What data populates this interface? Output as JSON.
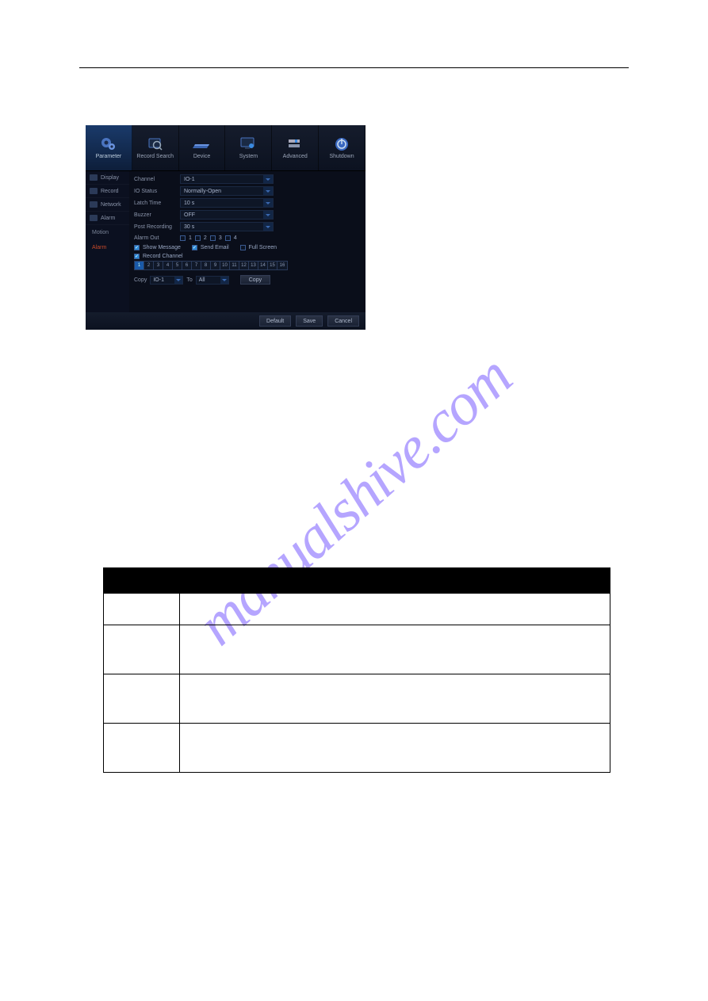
{
  "watermark": "manualshive.com",
  "toolbar": {
    "items": [
      {
        "label": "Parameter",
        "icon": "gears-icon",
        "active": true
      },
      {
        "label": "Record Search",
        "icon": "magnifier-icon"
      },
      {
        "label": "Device",
        "icon": "device-icon"
      },
      {
        "label": "System",
        "icon": "monitor-icon"
      },
      {
        "label": "Advanced",
        "icon": "advanced-icon"
      },
      {
        "label": "Shutdown",
        "icon": "power-icon"
      }
    ]
  },
  "sidebar": {
    "items": [
      {
        "label": "Display",
        "icon": "display-icon"
      },
      {
        "label": "Record",
        "icon": "record-icon"
      },
      {
        "label": "Network",
        "icon": "network-icon"
      },
      {
        "label": "Alarm",
        "icon": "alarm-icon"
      }
    ],
    "sub": [
      {
        "label": "Motion"
      },
      {
        "label": "Alarm",
        "active": true
      }
    ]
  },
  "form": {
    "channel": {
      "label": "Channel",
      "value": "IO-1"
    },
    "io_status": {
      "label": "IO Status",
      "value": "Normally-Open"
    },
    "latch_time": {
      "label": "Latch Time",
      "value": "10 s"
    },
    "buzzer": {
      "label": "Buzzer",
      "value": "OFF"
    },
    "post_recording": {
      "label": "Post Recording",
      "value": "30 s"
    },
    "alarm_out": {
      "label": "Alarm Out",
      "boxes": [
        "1",
        "2",
        "3",
        "4"
      ]
    },
    "flags": {
      "show_message": {
        "label": "Show Message",
        "checked": true
      },
      "send_email": {
        "label": "Send Email",
        "checked": true
      },
      "full_screen": {
        "label": "Full Screen",
        "checked": false
      }
    },
    "record_channel": {
      "label": "Record Channel",
      "checked": true
    },
    "channels": [
      "1",
      "2",
      "3",
      "4",
      "5",
      "6",
      "7",
      "8",
      "9",
      "10",
      "11",
      "12",
      "13",
      "14",
      "15",
      "16"
    ],
    "channel_selected": 1,
    "copy": {
      "label": "Copy",
      "from_value": "IO-1",
      "to_label": "To",
      "to_value": "All",
      "button": "Copy"
    }
  },
  "footer": {
    "default": "Default",
    "save": "Save",
    "cancel": "Cancel"
  },
  "table": {
    "rows": [
      {
        "c0": "",
        "c1": ""
      },
      {
        "c0": "",
        "c1": ""
      },
      {
        "c0": "",
        "c1": ""
      },
      {
        "c0": "",
        "c1": ""
      }
    ]
  }
}
